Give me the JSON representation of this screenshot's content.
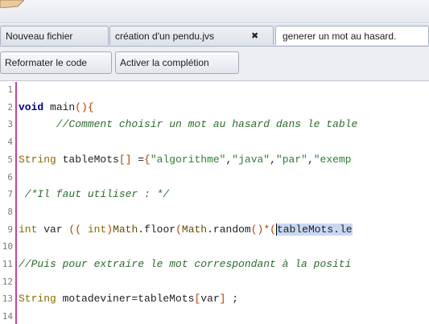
{
  "tabs": [
    {
      "label": "Nouveau fichier",
      "active": false,
      "closable": false
    },
    {
      "label": "création d'un pendu.jvs",
      "active": false,
      "closable": true,
      "close_icon": "close-icon"
    },
    {
      "label": "generer un mot au hasard.",
      "active": true,
      "closable": false
    }
  ],
  "toolbar": {
    "reformat_label": "Reformater le code",
    "completion_label": "Activer la complétion"
  },
  "editor": {
    "line_numbers": [
      "1",
      "2",
      "3",
      "4",
      "5",
      "6",
      "7",
      "8",
      "9",
      "10",
      "11",
      "12",
      "13",
      "14"
    ],
    "lines": [
      {
        "segments": []
      },
      {
        "segments": [
          {
            "t": "kw",
            "v": "void"
          },
          {
            "t": "plain",
            "v": " main"
          },
          {
            "t": "paren",
            "v": "(){"
          }
        ]
      },
      {
        "segments": [
          {
            "t": "cmt",
            "v": "      //Comment choisir un mot au hasard dans le table"
          }
        ]
      },
      {
        "segments": []
      },
      {
        "segments": [
          {
            "t": "type",
            "v": "String"
          },
          {
            "t": "plain",
            "v": " tableMots"
          },
          {
            "t": "paren",
            "v": "[]"
          },
          {
            "t": "plain",
            "v": " ="
          },
          {
            "t": "paren",
            "v": "{"
          },
          {
            "t": "str",
            "v": "\"algorithme\""
          },
          {
            "t": "plain",
            "v": ","
          },
          {
            "t": "str",
            "v": "\"java\""
          },
          {
            "t": "plain",
            "v": ","
          },
          {
            "t": "str",
            "v": "\"par\""
          },
          {
            "t": "plain",
            "v": ","
          },
          {
            "t": "str",
            "v": "\"exemp"
          }
        ]
      },
      {
        "segments": []
      },
      {
        "segments": [
          {
            "t": "cmt",
            "v": " /*Il faut utiliser : */"
          }
        ]
      },
      {
        "segments": []
      },
      {
        "segments": [
          {
            "t": "type",
            "v": "int"
          },
          {
            "t": "plain",
            "v": " var "
          },
          {
            "t": "paren",
            "v": "(("
          },
          {
            "t": "plain",
            "v": " "
          },
          {
            "t": "type",
            "v": "int"
          },
          {
            "t": "paren",
            "v": ")"
          },
          {
            "t": "fn",
            "v": "Math"
          },
          {
            "t": "plain",
            "v": ".floor"
          },
          {
            "t": "paren",
            "v": "("
          },
          {
            "t": "fn",
            "v": "Math"
          },
          {
            "t": "plain",
            "v": ".random"
          },
          {
            "t": "paren",
            "v": "()*("
          },
          {
            "t": "sel",
            "v": "tableMots.le"
          }
        ]
      },
      {
        "segments": []
      },
      {
        "segments": [
          {
            "t": "cmt",
            "v": "//Puis pour extraire le mot correspondant à la positi"
          }
        ]
      },
      {
        "segments": []
      },
      {
        "segments": [
          {
            "t": "type",
            "v": "String"
          },
          {
            "t": "plain",
            "v": " motadeviner=tableMots"
          },
          {
            "t": "paren",
            "v": "["
          },
          {
            "t": "plain",
            "v": "var"
          },
          {
            "t": "paren",
            "v": "]"
          },
          {
            "t": "plain",
            "v": " ;"
          }
        ]
      },
      {
        "segments": []
      }
    ]
  }
}
